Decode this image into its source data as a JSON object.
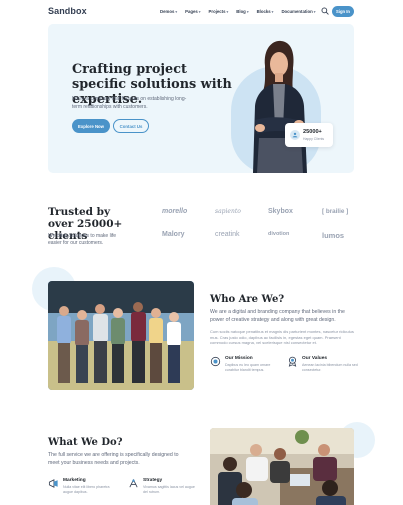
{
  "nav": {
    "logo": "Sandbox",
    "menu": [
      "Demos",
      "Pages",
      "Projects",
      "Blog",
      "Blocks",
      "Documentation"
    ],
    "signin_label": "Sign In"
  },
  "hero": {
    "title": "Crafting project specific solutions with expertise.",
    "subtitle": "We're a company that focuses on establishing long-term relationships with customers.",
    "explore_label": "Explore Now",
    "contact_label": "Contact Us",
    "stat_value": "25000+",
    "stat_label": "Happy Clients"
  },
  "trusted": {
    "title": "Trusted by over 25000+ clients",
    "subtitle": "We bring solutions to make life easier for our customers.",
    "clients": [
      "morello",
      "sapiento",
      "Skybox",
      "[ brailie ]",
      "Malory",
      "creatink",
      "divotion",
      "lumos"
    ]
  },
  "who": {
    "title": "Who Are We?",
    "paragraph1": "We are a digital and branding company that believes in the power of creative strategy and along with great design.",
    "paragraph2": "Cum sociis natoque penatibus et magnis dis parturient montes, nascetur ridiculus mus. Cras justo odio, dapibus ac facilisis in, egestas eget quam. Praesent commodo cursus magna, vel scelerisque nisl consectetur et.",
    "features": [
      {
        "title": "Our Mission",
        "text": "Dapibus eu leo quam ornare curabitur blandit tempus."
      },
      {
        "title": "Our Values",
        "text": "Aenean lacinia bibendum nulla sed consectetur."
      }
    ]
  },
  "what": {
    "title": "What We Do?",
    "paragraph": "The full service we are offering is specifically designed to meet your business needs and projects.",
    "features": [
      {
        "title": "Marketing",
        "text": "Nulla vitae elit libero pharetra augue dapibus."
      },
      {
        "title": "Strategy",
        "text": "Vivamus sagittis lacus vel augue del rutrum."
      }
    ]
  },
  "colors": {
    "accent": "#4a93c9",
    "hero_bg": "#edf6fb",
    "heading": "#21262c",
    "body": "#60697b"
  }
}
